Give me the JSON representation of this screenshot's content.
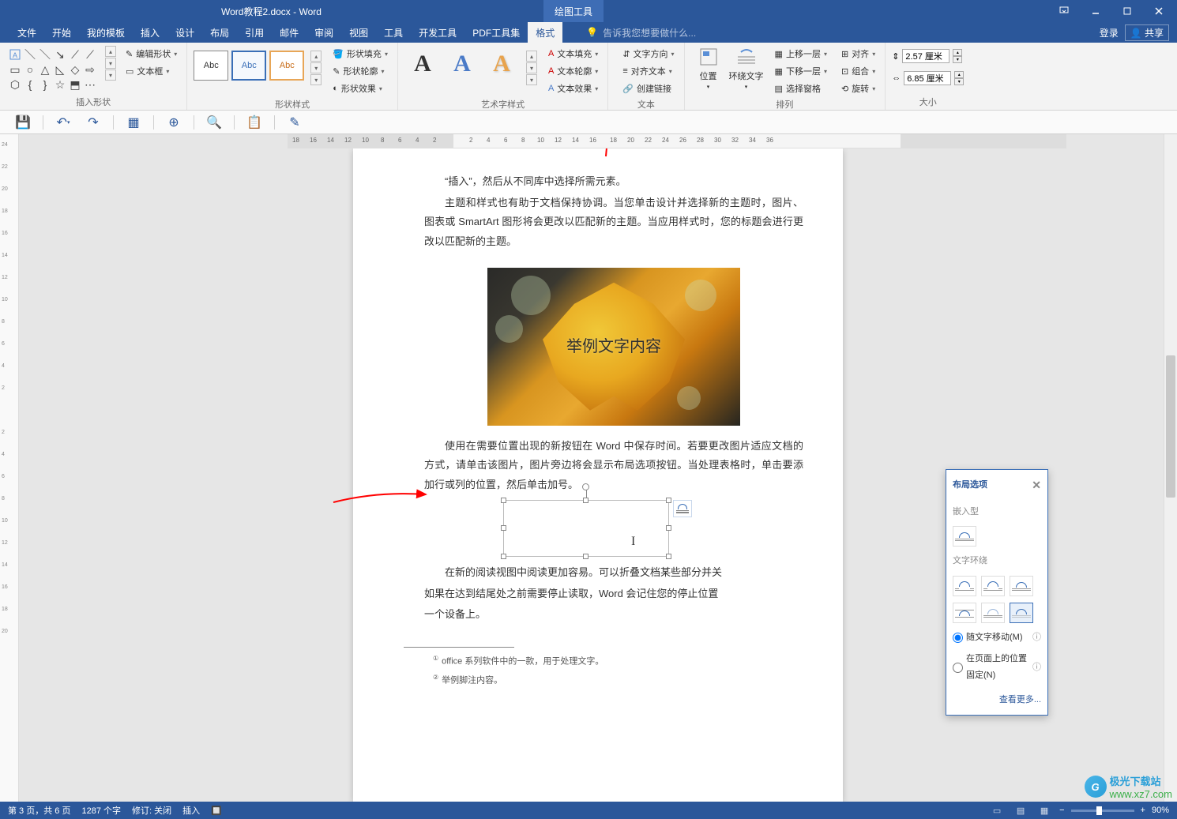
{
  "titlebar": {
    "doc": "Word教程2.docx - Word",
    "tool_tab": "绘图工具"
  },
  "menu": {
    "items": [
      "文件",
      "开始",
      "我的模板",
      "插入",
      "设计",
      "布局",
      "引用",
      "邮件",
      "审阅",
      "视图",
      "工具",
      "开发工具",
      "PDF工具集",
      "格式"
    ],
    "active": "格式",
    "tell_me": "告诉我您想要做什么...",
    "login": "登录",
    "share": "共享"
  },
  "ribbon": {
    "insert_shape": {
      "label": "插入形状",
      "edit_shape": "编辑形状",
      "text_box": "文本框"
    },
    "shape_style": {
      "label": "形状样式",
      "abc": "Abc",
      "fill": "形状填充",
      "outline": "形状轮廓",
      "effects": "形状效果"
    },
    "wordart": {
      "label": "艺术字样式",
      "text_fill": "文本填充",
      "text_outline": "文本轮廓",
      "text_effects": "文本效果"
    },
    "text": {
      "label": "文本",
      "direction": "文字方向",
      "align": "对齐文本",
      "link": "创建链接"
    },
    "arrange": {
      "label": "排列",
      "position": "位置",
      "wrap": "环绕文字",
      "fwd": "上移一层",
      "back": "下移一层",
      "pane": "选择窗格",
      "aln": "对齐",
      "grp": "组合",
      "rot": "旋转"
    },
    "size": {
      "label": "大小",
      "h": "2.57 厘米",
      "w": "6.85 厘米"
    }
  },
  "doc": {
    "p1": "“插入”，然后从不同库中选择所需元素。",
    "p2": "主题和样式也有助于文档保持协调。当您单击设计并选择新的主题时，图片、图表或 SmartArt 图形将会更改以匹配新的主题。当应用样式时，您的标题会进行更改以匹配新的主题。",
    "img_text": "举例文字内容",
    "p3": "使用在需要位置出现的新按钮在 Word 中保存时间。若要更改图片适应文档的方式，请单击该图片，图片旁边将会显示布局选项按钮。当处理表格时，单击要添加行或列的位置，然后单击加号。",
    "p4": "在新的阅读视图中阅读更加容易。可以折叠文档某些部分并关",
    "p5": "如果在达到结尾处之前需要停止读取，Word 会记住您的停止位置",
    "p6": "一个设备上。",
    "fn1": "office 系列软件中的一款，用于处理文字。",
    "fn2": "举例脚注内容。"
  },
  "layout_popup": {
    "title": "布局选项",
    "inline": "嵌入型",
    "wrap": "文字环绕",
    "r1": "随文字移动(M)",
    "r2": "在页面上的位置固定(N)",
    "more": "查看更多..."
  },
  "status": {
    "page": "第 3 页，共 6 页",
    "words": "1287 个字",
    "track": "修订: 关闭",
    "mode": "插入",
    "zoom": "90%"
  },
  "watermark": {
    "site": "极光下载站",
    "url": "www.xz7.com"
  }
}
